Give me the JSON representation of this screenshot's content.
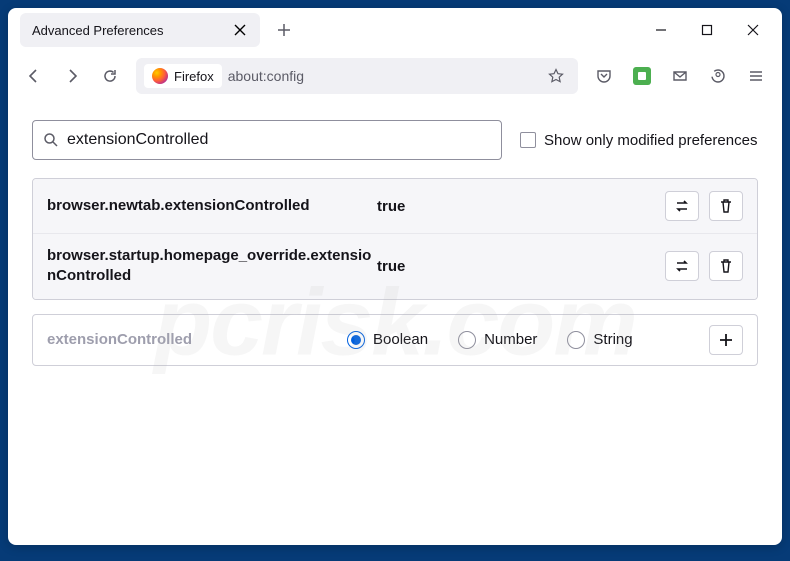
{
  "titlebar": {
    "tab_title": "Advanced Preferences"
  },
  "toolbar": {
    "identity_label": "Firefox",
    "url": "about:config"
  },
  "search": {
    "value": "extensionControlled",
    "checkbox_label": "Show only modified preferences"
  },
  "prefs": [
    {
      "name": "browser.newtab.extensionControlled",
      "value": "true"
    },
    {
      "name": "browser.startup.homepage_override.extensionControlled",
      "value": "true"
    }
  ],
  "new_pref": {
    "name": "extensionControlled",
    "types": [
      "Boolean",
      "Number",
      "String"
    ],
    "selected": 0
  },
  "watermark": "pcrisk.com"
}
